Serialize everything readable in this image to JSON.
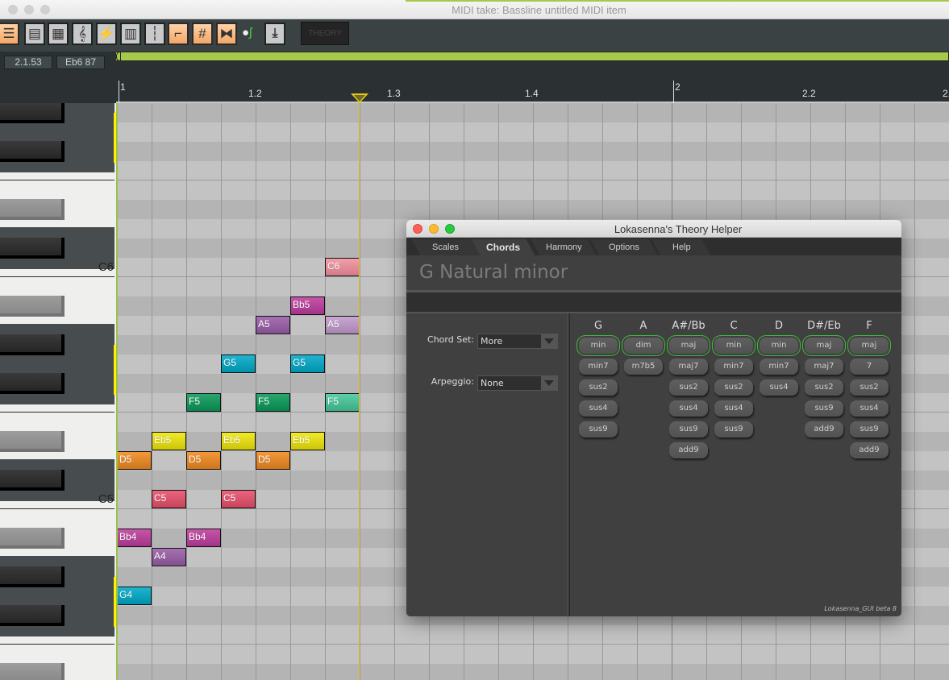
{
  "window": {
    "title": "MIDI take: Bassline untitled MIDI item"
  },
  "toolbar": {
    "buttons": [
      {
        "name": "piano-roll-view-icon",
        "active": true
      },
      {
        "name": "named-notes-view-icon",
        "active": false
      },
      {
        "name": "event-list-view-icon",
        "active": false
      },
      {
        "name": "notation-view-icon",
        "glyph": "𝄞",
        "active": false
      },
      {
        "name": "step-input-icon",
        "glyph": "⚡",
        "active": false
      },
      {
        "name": "cc-lanes-icon",
        "active": false
      },
      {
        "name": "grid-lanes-icon",
        "active": false
      },
      {
        "name": "snap-icon",
        "active": true
      },
      {
        "name": "grid-icon",
        "glyph": "#",
        "active": true
      },
      {
        "name": "mirror-icon",
        "active": true
      }
    ],
    "theory_label": "THEORY"
  },
  "infobar": {
    "position": "2.1.53",
    "note": "Eb6  87"
  },
  "ruler": {
    "labels": [
      {
        "text": "1",
        "major": true
      },
      {
        "text": "1.2",
        "major": false
      },
      {
        "text": "1.3",
        "major": false
      },
      {
        "text": "1.4",
        "major": false
      },
      {
        "text": "2",
        "major": true
      },
      {
        "text": "2.2",
        "major": false
      },
      {
        "text": "2.",
        "major": false
      }
    ]
  },
  "keyboard": {
    "labels": [
      {
        "text": "C6",
        "pitch": "C6"
      },
      {
        "text": "C5",
        "pitch": "C5"
      }
    ],
    "visible_range": [
      "G#6",
      "B3"
    ]
  },
  "notes": [
    {
      "pitch": "C6",
      "label": "C6",
      "step": 6,
      "color": "#f4919f"
    },
    {
      "pitch": "Bb5",
      "label": "Bb5",
      "step": 5,
      "color": "#bf3d9e"
    },
    {
      "pitch": "A5",
      "label": "A5",
      "step": 4,
      "color": "#9a5ea8"
    },
    {
      "pitch": "A5",
      "label": "A5",
      "step": 6,
      "color": "#c39bcd"
    },
    {
      "pitch": "G5",
      "label": "G5",
      "step": 3,
      "color": "#00aac9"
    },
    {
      "pitch": "G5",
      "label": "G5",
      "step": 5,
      "color": "#00aac9"
    },
    {
      "pitch": "F5",
      "label": "F5",
      "step": 2,
      "color": "#0a9a5a"
    },
    {
      "pitch": "F5",
      "label": "F5",
      "step": 4,
      "color": "#0a9a5a"
    },
    {
      "pitch": "F5",
      "label": "F5",
      "step": 6,
      "color": "#46c99a"
    },
    {
      "pitch": "Eb5",
      "label": "Eb5",
      "step": 1,
      "color": "#f0e70a"
    },
    {
      "pitch": "Eb5",
      "label": "Eb5",
      "step": 3,
      "color": "#f0e70a"
    },
    {
      "pitch": "Eb5",
      "label": "Eb5",
      "step": 5,
      "color": "#f0e70a"
    },
    {
      "pitch": "D5",
      "label": "D5",
      "step": 0,
      "color": "#f28a20"
    },
    {
      "pitch": "D5",
      "label": "D5",
      "step": 2,
      "color": "#f28a20"
    },
    {
      "pitch": "D5",
      "label": "D5",
      "step": 4,
      "color": "#f28a20"
    },
    {
      "pitch": "C5",
      "label": "C5",
      "step": 1,
      "color": "#e9506b"
    },
    {
      "pitch": "C5",
      "label": "C5",
      "step": 3,
      "color": "#e9506b"
    },
    {
      "pitch": "Bb4",
      "label": "Bb4",
      "step": 0,
      "color": "#bf3d9e"
    },
    {
      "pitch": "Bb4",
      "label": "Bb4",
      "step": 2,
      "color": "#bf3d9e"
    },
    {
      "pitch": "A4",
      "label": "A4",
      "step": 1,
      "color": "#9a5ea8"
    },
    {
      "pitch": "G4",
      "label": "G4",
      "step": 0,
      "color": "#00aac9"
    }
  ],
  "theory_helper": {
    "title": "Lokasenna's Theory Helper",
    "tabs": [
      {
        "label": "Scales",
        "active": false
      },
      {
        "label": "Chords",
        "active": true
      },
      {
        "label": "Harmony",
        "active": false
      },
      {
        "label": "Options",
        "active": false
      },
      {
        "label": "Help",
        "active": false
      }
    ],
    "scale_title": "G Natural minor",
    "chord_set": {
      "label": "Chord Set:",
      "value": "More"
    },
    "arpeggio": {
      "label": "Arpeggio:",
      "value": "None"
    },
    "columns": [
      {
        "root": "G",
        "chords": [
          "min",
          "min7",
          "sus2",
          "sus4",
          "sus9"
        ]
      },
      {
        "root": "A",
        "chords": [
          "dim",
          "m7b5"
        ]
      },
      {
        "root": "A#/Bb",
        "chords": [
          "maj",
          "maj7",
          "sus2",
          "sus4",
          "sus9",
          "add9"
        ]
      },
      {
        "root": "C",
        "chords": [
          "min",
          "min7",
          "sus2",
          "sus4",
          "sus9"
        ]
      },
      {
        "root": "D",
        "chords": [
          "min",
          "min7",
          "sus4"
        ]
      },
      {
        "root": "D#/Eb",
        "chords": [
          "maj",
          "maj7",
          "sus2",
          "sus9",
          "add9"
        ]
      },
      {
        "root": "F",
        "chords": [
          "maj",
          "7",
          "sus2",
          "sus4",
          "sus9",
          "add9"
        ]
      }
    ],
    "footer": "Lokasenna_GUI beta 8"
  }
}
